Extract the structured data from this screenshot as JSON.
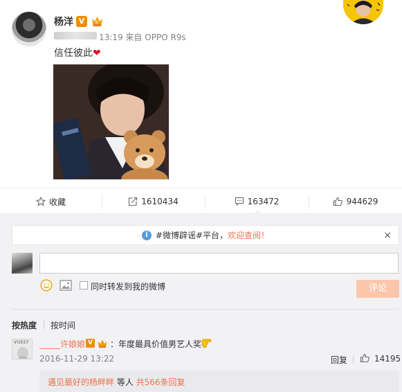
{
  "post": {
    "username": "杨洋",
    "verified_badge": "V",
    "time": "13:19",
    "source_prefix": "来自",
    "source_device": "OPPO R9s",
    "text": "信任彼此",
    "text_emoji": "❤"
  },
  "actions": {
    "favorite_label": "收藏",
    "repost_count": "1610434",
    "comment_count": "163472",
    "like_count": "944629"
  },
  "notice": {
    "hashtag": "#微博辟谣#平台，",
    "link": "欢迎查阅！",
    "close": "×"
  },
  "composer": {
    "forward_label": "同时转发到我的微博",
    "submit_label": "评论"
  },
  "sort": {
    "hot_label": "按热度",
    "time_label": "按时间"
  },
  "comment": {
    "avatar_text": "VOEEF",
    "name": "_____许娘娘",
    "verified_badge": "V",
    "text": "：年度最具价值男艺人奖",
    "date": "2016-11-29 13:22",
    "reply_label": "回复",
    "like_count": "14195"
  },
  "sub_replies": {
    "names": "遇见最好的杨畔畔",
    "middle": " 等人 ",
    "count": "共566条回复"
  },
  "colors": {
    "accent_orange": "#eb7350",
    "verified_orange": "#f08c00",
    "submit_disabled": "#fbc6ac",
    "comment_bg": "#f2f2f5",
    "info_blue": "#5a9bd5"
  }
}
